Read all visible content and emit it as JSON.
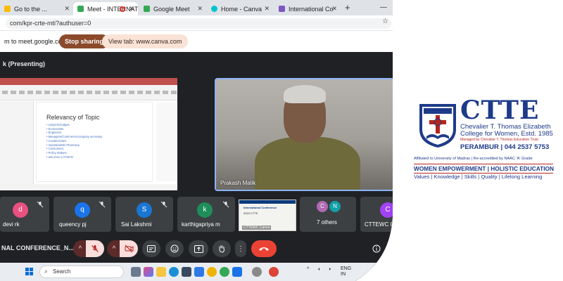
{
  "browser": {
    "tabs": [
      {
        "label": "Go to the ...",
        "active": false
      },
      {
        "label": "Meet - INTERNATI",
        "active": true
      },
      {
        "label": "Google Meet",
        "active": false
      },
      {
        "label": "Home - Canva",
        "active": false
      },
      {
        "label": "International Co",
        "active": false
      }
    ],
    "new_tab": "+",
    "url": "com/kpr-crte-mti?authuser=0"
  },
  "share_bar": {
    "text": "m to meet.google.com",
    "stop_label": "Stop sharing",
    "view_label": "View tab: www.canva.com"
  },
  "meet": {
    "presenting_label": "k (Presenting)",
    "slide": {
      "title": "Relevancy of Topic",
      "bullets": [
        "• Lawyers/Judges",
        "• Economists",
        "• Engineers",
        "• Managers/Commerce/company secretary",
        "• Academicians",
        "• Industrialists/ Pharmacy",
        "• Consumers,",
        "• Policy Makers",
        "• and even LAYMAN"
      ]
    },
    "speaker_name": "Prakash Malik",
    "participants": [
      {
        "name": "devi rk",
        "initial": "d",
        "color": "#e8507f"
      },
      {
        "name": "queency pj",
        "initial": "q",
        "color": "#1a73e8"
      },
      {
        "name": "Sai Lakshmi",
        "initial": "S",
        "color": "#1976d2"
      },
      {
        "name": "karthigapriya m",
        "initial": "k",
        "color": "#1e8e5a"
      }
    ],
    "thumb_banner": {
      "line1": "International Conference",
      "line2": "2023 CTTE",
      "label": "CTTEWC Canva"
    },
    "others": {
      "avatars": [
        "C",
        "N"
      ],
      "label": "7 others"
    },
    "last_tile": {
      "name": "CTTEWC C",
      "initial": "C",
      "color": "#a142f4"
    },
    "meeting_title": "NAL CONFERENCE_N..."
  },
  "taskbar": {
    "search_placeholder": "Search",
    "lang": "ENG",
    "region": "IN"
  },
  "logo": {
    "acronym": "CTTE",
    "college_line1": "Chevalier T. Thomas Elizabeth",
    "college_line2": "College for Women, Estd. 1985",
    "managed_by": "Managed by Chevalier T. Thomas Education Trust",
    "location": "PERAMBUR | 044 2537 5753",
    "affiliation": "Affiliated to University of Madras | Re-accredited by NAAC 'A' Grade",
    "tagline": "WOMEN EMPOWERMENT | HOLISTIC EDUCATION",
    "values": "Values | Knowledge | Skills | Quality | Lifelong Learning",
    "brand_color": "#1e3b8a",
    "accent_color": "#b3261e"
  }
}
